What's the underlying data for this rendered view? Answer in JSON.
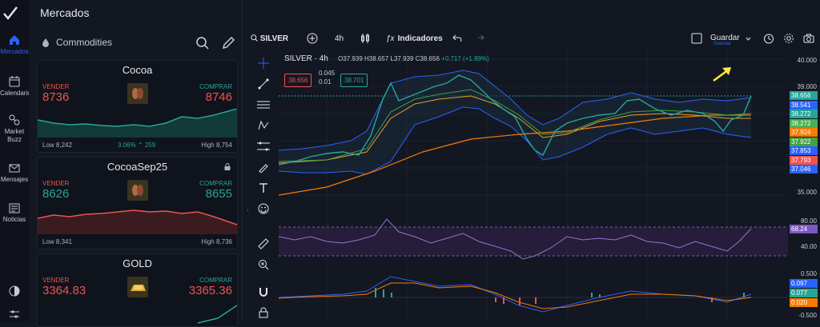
{
  "sidebar": {
    "items": [
      {
        "label": "Mercados",
        "icon": "home-icon"
      },
      {
        "label": "Calendario",
        "icon": "calendar-icon"
      },
      {
        "label": "Market Buzz",
        "icon": "buzz-icon"
      },
      {
        "label": "Mensajes",
        "icon": "mail-icon"
      },
      {
        "label": "Noticias",
        "icon": "news-icon"
      }
    ]
  },
  "panel": {
    "title": "Mercados",
    "category": "Commodities",
    "cards": [
      {
        "name": "Cocoa",
        "sell_label": "VENDER",
        "sell": "8736",
        "buy_label": "COMPRAR",
        "buy": "8746",
        "low": "Low 8,242",
        "change": "3.06% ⌃ 259",
        "high": "High 8,754",
        "trend": "up"
      },
      {
        "name": "CocoaSep25",
        "sell_label": "VENDER",
        "sell": "8626",
        "buy_label": "COMPRAR",
        "buy": "8655",
        "low": "Low 8,341",
        "change": "",
        "high": "High 8,736",
        "trend": "down"
      },
      {
        "name": "GOLD",
        "sell_label": "VENDER",
        "sell": "3364.83",
        "buy_label": "COMPRAR",
        "buy": "3365.36",
        "low": "",
        "change": "",
        "high": "",
        "trend": "up"
      }
    ]
  },
  "toolbar": {
    "symbol": "SILVER",
    "interval": "4h",
    "indicators": "Indicadores",
    "save": "Guardar",
    "save_sub": "Guardar"
  },
  "chart_header": {
    "title": "SILVER · 4h",
    "open": "O37.939",
    "high": "H38.657",
    "low": "L37.939",
    "close": "C38.656",
    "change": "+0.717 (+1.89%)",
    "sell_box": "38.656",
    "spread_top": "0.045",
    "spread_bottom": "0.01",
    "buy_box": "38.701"
  },
  "price_axis": {
    "ticks": [
      "40.000",
      "39.000",
      "35.000"
    ],
    "tags": [
      {
        "v": "38.656",
        "c": "#26a69a"
      },
      {
        "v": "38.541",
        "c": "#2962ff"
      },
      {
        "v": "38.272",
        "c": "#26a69a"
      },
      {
        "v": "38.272",
        "c": "#4caf50"
      },
      {
        "v": "37.924",
        "c": "#f57c00"
      },
      {
        "v": "37.922",
        "c": "#43a047"
      },
      {
        "v": "37.853",
        "c": "#2962ff"
      },
      {
        "v": "37.793",
        "c": "#ef5350"
      },
      {
        "v": "37.046",
        "c": "#2962ff"
      }
    ],
    "rsi_ticks": [
      "80.00",
      "40.00"
    ],
    "rsi_tag": "68.24",
    "macd_ticks": [
      "0.500",
      "-0.500"
    ],
    "macd_tags": [
      {
        "v": "0.097",
        "c": "#2962ff"
      },
      {
        "v": "0.077",
        "c": "#26a69a"
      },
      {
        "v": "0.020",
        "c": "#f57c00"
      }
    ]
  },
  "colors": {
    "up": "#26a69a",
    "down": "#ef5350",
    "accent": "#2962ff",
    "band": "#2962ff",
    "ema": "#f57c00"
  }
}
